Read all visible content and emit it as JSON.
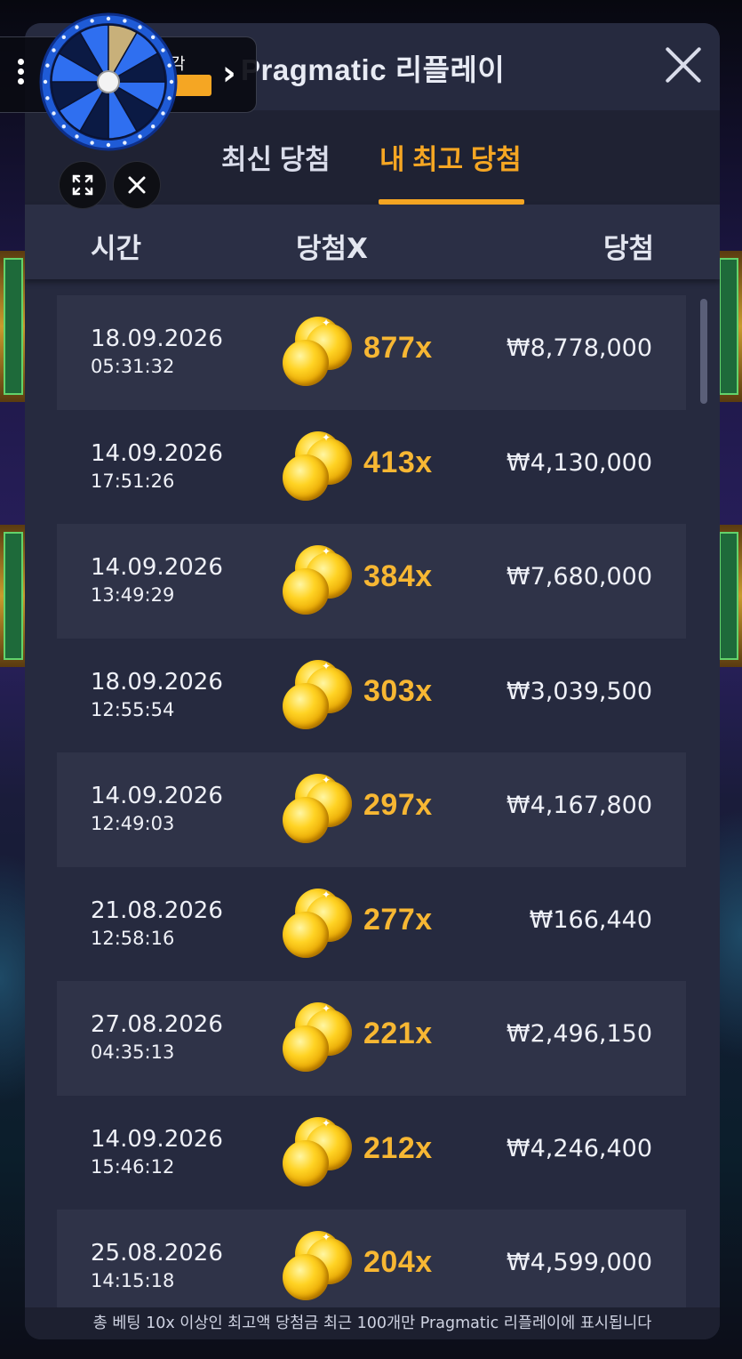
{
  "panel": {
    "title": "Pragmatic 리플레이",
    "close_label": "×"
  },
  "tabs": [
    {
      "label": "최신 당첨",
      "active": false
    },
    {
      "label": "내 최고 당첨",
      "active": true
    }
  ],
  "columns": {
    "time": "시간",
    "multiplier": "당첨X",
    "win": "당첨"
  },
  "rows": [
    {
      "date": "18.09.2026",
      "time": "05:31:32",
      "multiplier": "877x",
      "win": "₩8,778,000",
      "coins": 3
    },
    {
      "date": "14.09.2026",
      "time": "17:51:26",
      "multiplier": "413x",
      "win": "₩4,130,000",
      "coins": 2
    },
    {
      "date": "14.09.2026",
      "time": "13:49:29",
      "multiplier": "384x",
      "win": "₩7,680,000",
      "coins": 2
    },
    {
      "date": "18.09.2026",
      "time": "12:55:54",
      "multiplier": "303x",
      "win": "₩3,039,500",
      "coins": 2
    },
    {
      "date": "14.09.2026",
      "time": "12:49:03",
      "multiplier": "297x",
      "win": "₩4,167,800",
      "coins": 2
    },
    {
      "date": "21.08.2026",
      "time": "12:58:16",
      "multiplier": "277x",
      "win": "₩166,440",
      "coins": 2
    },
    {
      "date": "27.08.2026",
      "time": "04:35:13",
      "multiplier": "221x",
      "win": "₩2,496,150",
      "coins": 2
    },
    {
      "date": "14.09.2026",
      "time": "15:46:12",
      "multiplier": "212x",
      "win": "₩4,246,400",
      "coins": 2
    },
    {
      "date": "25.08.2026",
      "time": "14:15:18",
      "multiplier": "204x",
      "win": "₩4,599,000",
      "coins": 2
    }
  ],
  "footer": {
    "note": "총 베팅 10x 이상인 최고액 당첨금 최근 100개만 Pragmatic 리플레이에 표시됩니다"
  },
  "overlay": {
    "label": "각",
    "chevron": "›",
    "icons": [
      "kebab-menu-icon",
      "prize-wheel-icon",
      "expand-icon",
      "close-icon"
    ]
  },
  "colors": {
    "accent": "#f5a623",
    "panel_bg": "#262a3f",
    "row_shade": "#2f3348",
    "multiplier": "#f7b733"
  }
}
